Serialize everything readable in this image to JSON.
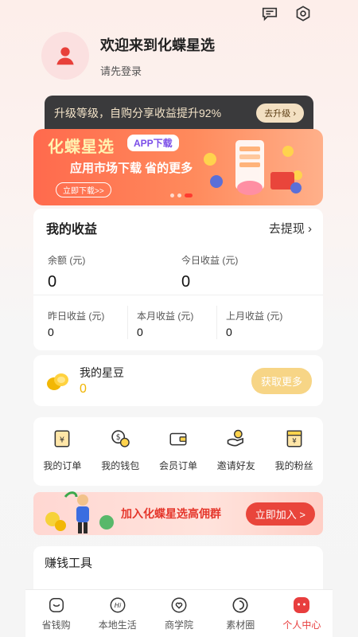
{
  "profile": {
    "welcome": "欢迎来到化蝶星选",
    "login_prompt": "请先登录"
  },
  "upgrade_bar": {
    "text": "升级等级，自购分享收益提升92%",
    "button": "去升级 ›"
  },
  "banner": {
    "brand": "化蝶星选",
    "app_tag": "APP下载",
    "slogan": "应用市场下载 省的更多",
    "download": "立即下载>>"
  },
  "earnings": {
    "title": "我的收益",
    "withdraw": "去提现 ›",
    "balance_label": "余额 (元)",
    "balance_value": "0",
    "today_label": "今日收益 (元)",
    "today_value": "0",
    "yesterday_label": "昨日收益 (元)",
    "yesterday_value": "0",
    "month_label": "本月收益 (元)",
    "month_value": "0",
    "last_month_label": "上月收益 (元)",
    "last_month_value": "0"
  },
  "beans": {
    "title": "我的星豆",
    "value": "0",
    "button": "获取更多"
  },
  "menu": [
    {
      "label": "我的订单",
      "icon": "order-icon"
    },
    {
      "label": "我的钱包",
      "icon": "wallet-icon"
    },
    {
      "label": "会员订单",
      "icon": "member-order-icon"
    },
    {
      "label": "邀请好友",
      "icon": "invite-icon"
    },
    {
      "label": "我的粉丝",
      "icon": "fans-icon"
    }
  ],
  "group_banner": {
    "text": "加入化蝶星选高佣群",
    "button": "立即加入 >"
  },
  "tools": {
    "title": "赚钱工具"
  },
  "tabbar": [
    {
      "label": "省钱购",
      "icon": "shop-icon"
    },
    {
      "label": "本地生活",
      "icon": "local-life-icon"
    },
    {
      "label": "商学院",
      "icon": "academy-icon"
    },
    {
      "label": "素材圈",
      "icon": "material-icon"
    },
    {
      "label": "个人中心",
      "icon": "profile-icon",
      "active": true
    }
  ],
  "colors": {
    "accent": "#e83e3e",
    "gold": "#f0b400",
    "dark_bar": "#3a3a3c"
  }
}
